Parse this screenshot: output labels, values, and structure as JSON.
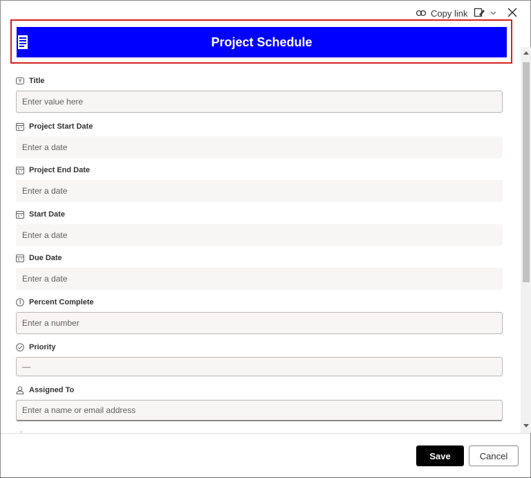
{
  "toolbar": {
    "copy_link_label": "Copy link"
  },
  "header": {
    "title": "Project Schedule",
    "background_color": "#0000ff",
    "highlight_color": "#d32222"
  },
  "form": {
    "fields": [
      {
        "label": "Title",
        "placeholder": "Enter value here",
        "icon": "text-field-icon"
      },
      {
        "label": "Project Start Date",
        "placeholder": "Enter a date",
        "icon": "calendar-icon"
      },
      {
        "label": "Project End Date",
        "placeholder": "Enter a date",
        "icon": "calendar-icon"
      },
      {
        "label": "Start Date",
        "placeholder": "Enter a date",
        "icon": "calendar-icon"
      },
      {
        "label": "Due Date",
        "placeholder": "Enter a date",
        "icon": "calendar-icon"
      },
      {
        "label": "Percent Complete",
        "placeholder": "Enter a number",
        "icon": "number-icon"
      },
      {
        "label": "Priority",
        "value": "—",
        "icon": "choice-check-icon"
      },
      {
        "label": "Assigned To",
        "placeholder": "Enter a name or email address",
        "icon": "person-icon"
      }
    ]
  },
  "footer": {
    "save_label": "Save",
    "cancel_label": "Cancel"
  }
}
